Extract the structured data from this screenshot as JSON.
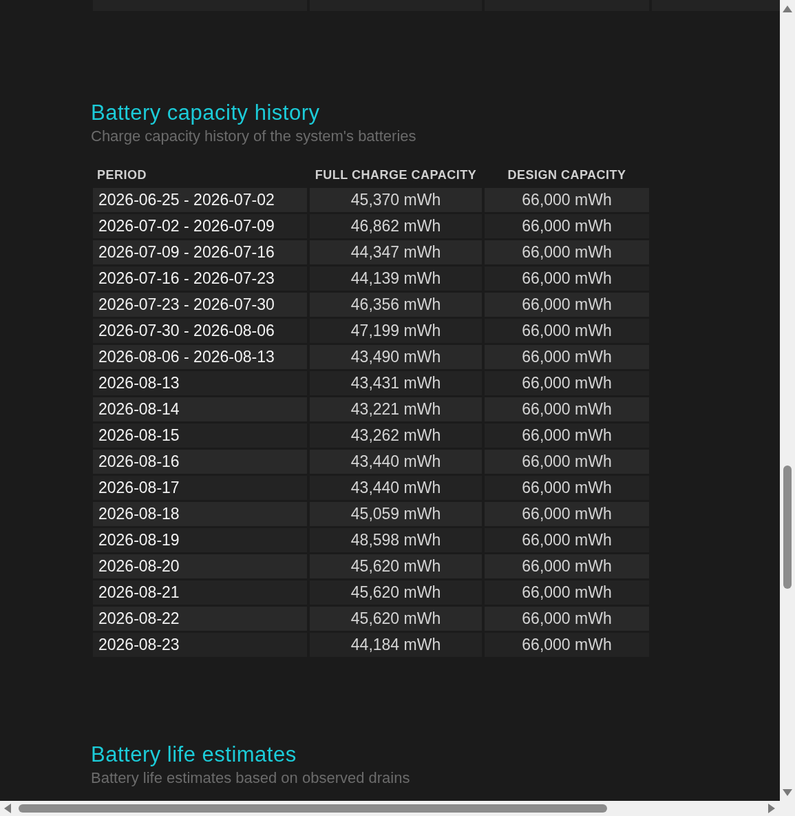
{
  "capacity_history": {
    "title": "Battery capacity history",
    "subtitle": "Charge capacity history of the system's batteries",
    "columns": [
      "PERIOD",
      "FULL CHARGE CAPACITY",
      "DESIGN CAPACITY"
    ],
    "rows": [
      [
        "2026-06-25 - 2026-07-02",
        "45,370 mWh",
        "66,000 mWh"
      ],
      [
        "2026-07-02 - 2026-07-09",
        "46,862 mWh",
        "66,000 mWh"
      ],
      [
        "2026-07-09 - 2026-07-16",
        "44,347 mWh",
        "66,000 mWh"
      ],
      [
        "2026-07-16 - 2026-07-23",
        "44,139 mWh",
        "66,000 mWh"
      ],
      [
        "2026-07-23 - 2026-07-30",
        "46,356 mWh",
        "66,000 mWh"
      ],
      [
        "2026-07-30 - 2026-08-06",
        "47,199 mWh",
        "66,000 mWh"
      ],
      [
        "2026-08-06 - 2026-08-13",
        "43,490 mWh",
        "66,000 mWh"
      ],
      [
        "2026-08-13",
        "43,431 mWh",
        "66,000 mWh"
      ],
      [
        "2026-08-14",
        "43,221 mWh",
        "66,000 mWh"
      ],
      [
        "2026-08-15",
        "43,262 mWh",
        "66,000 mWh"
      ],
      [
        "2026-08-16",
        "43,440 mWh",
        "66,000 mWh"
      ],
      [
        "2026-08-17",
        "43,440 mWh",
        "66,000 mWh"
      ],
      [
        "2026-08-18",
        "45,059 mWh",
        "66,000 mWh"
      ],
      [
        "2026-08-19",
        "48,598 mWh",
        "66,000 mWh"
      ],
      [
        "2026-08-20",
        "45,620 mWh",
        "66,000 mWh"
      ],
      [
        "2026-08-21",
        "45,620 mWh",
        "66,000 mWh"
      ],
      [
        "2026-08-22",
        "45,620 mWh",
        "66,000 mWh"
      ],
      [
        "2026-08-23",
        "44,184 mWh",
        "66,000 mWh"
      ]
    ]
  },
  "life_estimates": {
    "title": "Battery life estimates",
    "subtitle": "Battery life estimates based on observed drains"
  }
}
